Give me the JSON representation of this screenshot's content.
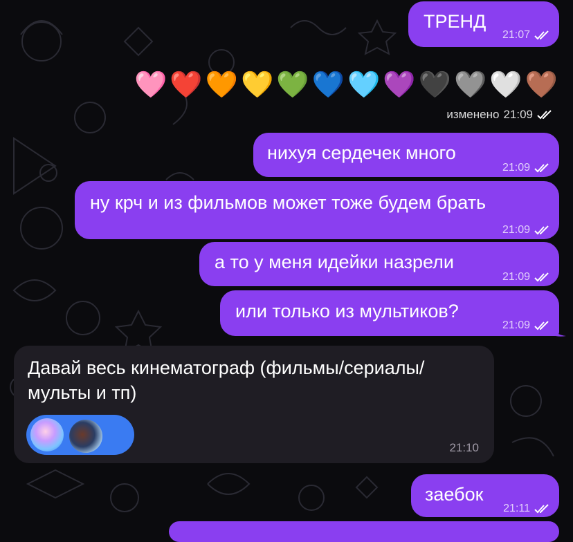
{
  "messages": [
    {
      "text": "ТРЕНД",
      "time": "21:07"
    },
    {
      "text": "нихуя сердечек много",
      "time": "21:09"
    },
    {
      "text": "ну крч и из фильмов может тоже будем брать",
      "time": "21:09"
    },
    {
      "text": "а то у меня идейки назрели",
      "time": "21:09"
    },
    {
      "text": "или только из мультиков?",
      "time": "21:09"
    },
    {
      "text": "заебок",
      "time": "21:11"
    }
  ],
  "hearts_message": {
    "hearts": [
      "🩷",
      "❤️",
      "🧡",
      "💛",
      "💚",
      "💙",
      "🩵",
      "💜",
      "🖤",
      "🩶",
      "🤍",
      "🤎"
    ],
    "edited_label": "изменено",
    "time": "21:09"
  },
  "incoming": {
    "line1": "Давай весь кинематограф (фильмы/сериалы/",
    "line2": "мульты и тп)",
    "time": "21:10",
    "reactions": [
      "rose-reaction-icon",
      "photo-reaction-avatar"
    ]
  },
  "colors": {
    "outgoing_bubble": "#8a3ff0",
    "incoming_bubble": "#1f1d24",
    "reaction_pill": "#3a7bf2",
    "background": "#0b0b0e"
  }
}
